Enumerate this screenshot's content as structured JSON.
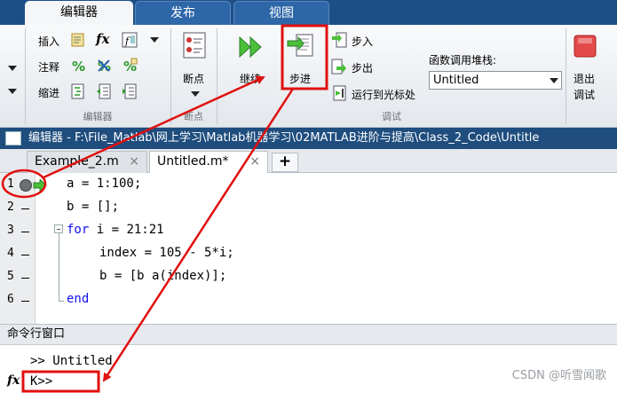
{
  "tabs": [
    {
      "label": "编辑器",
      "active": true
    },
    {
      "label": "发布",
      "active": false
    },
    {
      "label": "视图",
      "active": false
    }
  ],
  "ribbon": {
    "editor_group": {
      "label": "编辑器",
      "insert": "插入",
      "comment": "注释",
      "indent": "缩进",
      "fx_label": "fx"
    },
    "breakpoint_group": {
      "label": "断点",
      "button": "断点"
    },
    "debug_group": {
      "label": "调试",
      "continue": "继续",
      "step": "步进",
      "step_in": "步入",
      "step_out": "步出",
      "run_to_cursor": "运行到光标处",
      "stack_label": "函数调用堆栈:",
      "stack_value": "Untitled",
      "quit": "退出",
      "quit2": "调试"
    }
  },
  "title_bar": {
    "text": "编辑器 - F:\\File_Matlab\\网上学习\\Matlab机器学习\\02MATLAB进阶与提高\\Class_2_Code\\Untitle"
  },
  "doc_tabs": [
    {
      "label": "Example_2.m",
      "close": "×"
    },
    {
      "label": "Untitled.m*",
      "close": "×"
    }
  ],
  "add_tab": "+",
  "code_lines": [
    {
      "num": "1",
      "text": "a = 1:100;"
    },
    {
      "num": "2",
      "text": "b = [];"
    },
    {
      "num": "3",
      "kw": "for",
      "text": " i = 21:21"
    },
    {
      "num": "4",
      "text": "index = 105 - 5*i;"
    },
    {
      "num": "5",
      "text": "b = [b a(index)];"
    },
    {
      "num": "6",
      "kw": "end",
      "text": ""
    }
  ],
  "command_window": {
    "title": "命令行窗口",
    "output": ">> Untitled",
    "prompt": "K>>",
    "fx": "fx"
  },
  "watermark": "CSDN @听雪闻歌",
  "colors": {
    "tab_bar": "#1d4f87",
    "title_bar": "#1e4d7e",
    "annotation": "#e01010",
    "keyword": "#1111ee",
    "arrow_green": "#2aa52a"
  },
  "icons": [
    "insert-icon",
    "fx-icon",
    "comment-percent-icon",
    "indent-icon",
    "breakpoint-icon",
    "continue-icon",
    "step-icon",
    "step-in-icon",
    "step-out-icon",
    "run-to-cursor-icon",
    "quit-debug-icon",
    "breakpoint-dot-icon",
    "current-line-arrow-icon"
  ]
}
